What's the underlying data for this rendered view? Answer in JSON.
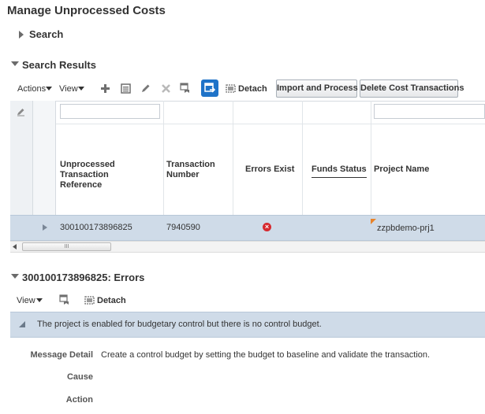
{
  "page": {
    "title": "Manage Unprocessed Costs"
  },
  "search": {
    "label": "Search"
  },
  "results": {
    "title": "Search Results",
    "toolbar": {
      "actions_label": "Actions",
      "view_label": "View",
      "detach_label": "Detach",
      "import_button": "Import and Process",
      "delete_button": "Delete Cost Transactions"
    },
    "columns": [
      {
        "line1": "Unprocessed Transaction",
        "line2": "Reference"
      },
      {
        "line1": "Transaction",
        "line2": "Number"
      },
      {
        "line1": "Errors Exist",
        "line2": ""
      },
      {
        "line1": "Funds Status",
        "line2": ""
      },
      {
        "line1": "Project Name",
        "line2": ""
      }
    ],
    "row": {
      "reference": "300100173896825",
      "transaction_number": "7940590",
      "errors_exist": "×",
      "project_name": "zzpbdemo-prj1"
    },
    "scroll_thumb_text": "III"
  },
  "errors": {
    "title": "300100173896825: Errors",
    "view_label": "View",
    "detach_label": "Detach",
    "message": "The project is enabled for budgetary control but there is no control budget.",
    "message_detail_label": "Message Detail",
    "message_detail": "Create a control budget by setting the budget to baseline and validate the transaction.",
    "cause_label": "Cause",
    "action_label": "Action"
  },
  "colors": {
    "selected_row": "#cfdbe8",
    "error_red": "#d6292f",
    "toolbar_active_blue": "#1f73c8"
  }
}
